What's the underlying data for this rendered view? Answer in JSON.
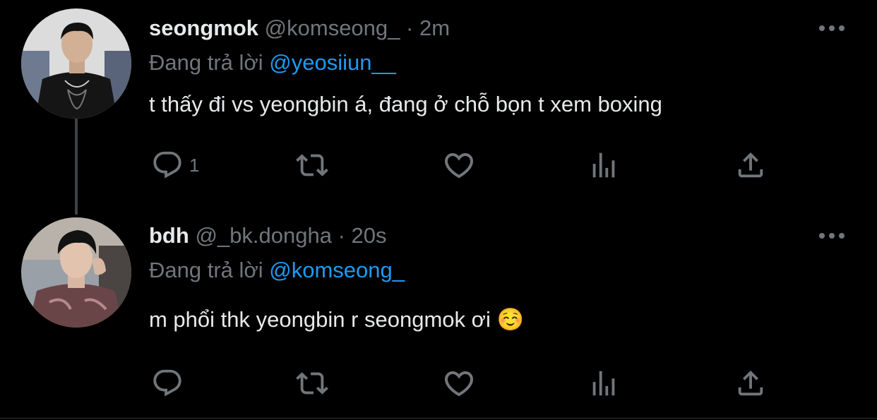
{
  "tweets": [
    {
      "name": "seongmok",
      "handle": "@komseong_",
      "separator": "·",
      "time": "2m",
      "reply_prefix": "Đang trả lời",
      "reply_to": "@yeosiiun__",
      "text": "t thấy đi vs yeongbin á, đang ở chỗ bọn t xem boxing",
      "reply_count": "1"
    },
    {
      "name": "bdh",
      "handle": "@_bk.dongha",
      "separator": "·",
      "time": "20s",
      "reply_prefix": "Đang trả lời",
      "reply_to": "@komseong_",
      "text": "m phổi thk yeongbin r seongmok ơi ☺️",
      "reply_count": ""
    }
  ],
  "icons": {
    "reply": "reply-icon",
    "retweet": "retweet-icon",
    "like": "heart-icon",
    "views": "views-icon",
    "share": "share-icon",
    "more": "more-icon"
  },
  "colors": {
    "background": "#000000",
    "primary_text": "#e7e9ea",
    "secondary_text": "#71767b",
    "mention": "#1d9bf0",
    "thread_line": "#3e4144"
  }
}
